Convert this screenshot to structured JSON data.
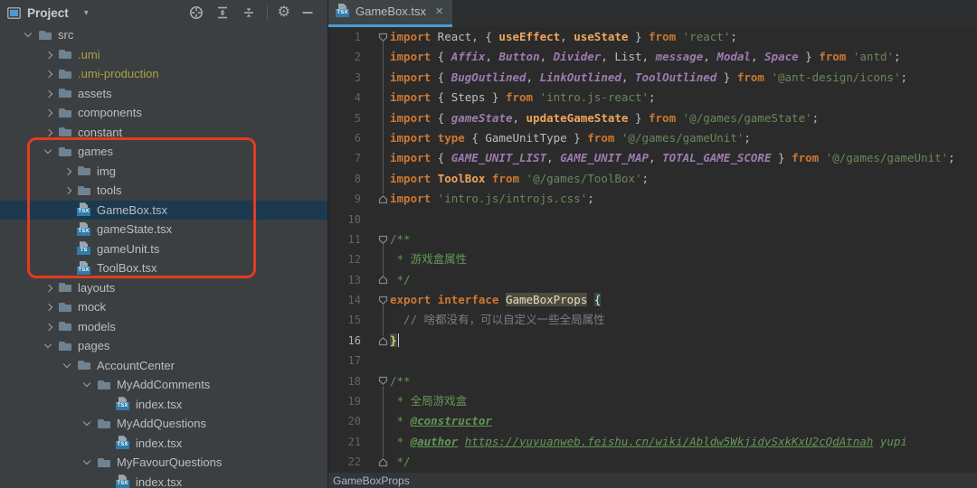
{
  "panel": {
    "header": {
      "title": "Project",
      "dropdown_glyph": "▾",
      "gear_glyph": "⚙",
      "icons": [
        "locate",
        "expand-all",
        "collapse-all",
        "settings",
        "hide-panel"
      ]
    },
    "tree": {
      "rows": [
        {
          "label": "src",
          "level": 0,
          "chev": "open",
          "icon": "folder"
        },
        {
          "label": ".umi",
          "level": 1,
          "chev": "closed",
          "icon": "folder",
          "excluded": true
        },
        {
          "label": ".umi-production",
          "level": 1,
          "chev": "closed",
          "icon": "folder",
          "excluded": true
        },
        {
          "label": "assets",
          "level": 1,
          "chev": "closed",
          "icon": "folder"
        },
        {
          "label": "components",
          "level": 1,
          "chev": "closed",
          "icon": "folder"
        },
        {
          "label": "constant",
          "level": 1,
          "chev": "closed",
          "icon": "folder"
        },
        {
          "label": "games",
          "level": 1,
          "chev": "open",
          "icon": "folder"
        },
        {
          "label": "img",
          "level": 2,
          "chev": "closed",
          "icon": "folder"
        },
        {
          "label": "tools",
          "level": 2,
          "chev": "closed",
          "icon": "folder"
        },
        {
          "label": "GameBox.tsx",
          "level": 2,
          "chev": "none",
          "icon": "tsx",
          "selected": true
        },
        {
          "label": "gameState.tsx",
          "level": 2,
          "chev": "none",
          "icon": "tsx"
        },
        {
          "label": "gameUnit.ts",
          "level": 2,
          "chev": "none",
          "icon": "ts"
        },
        {
          "label": "ToolBox.tsx",
          "level": 2,
          "chev": "none",
          "icon": "tsx"
        },
        {
          "label": "layouts",
          "level": 1,
          "chev": "closed",
          "icon": "folder"
        },
        {
          "label": "mock",
          "level": 1,
          "chev": "closed",
          "icon": "folder"
        },
        {
          "label": "models",
          "level": 1,
          "chev": "closed",
          "icon": "folder"
        },
        {
          "label": "pages",
          "level": 1,
          "chev": "open",
          "icon": "folder"
        },
        {
          "label": "AccountCenter",
          "level": 2,
          "chev": "open",
          "icon": "folder"
        },
        {
          "label": "MyAddComments",
          "level": 3,
          "chev": "open",
          "icon": "folder"
        },
        {
          "label": "index.tsx",
          "level": 4,
          "chev": "none",
          "icon": "tsx"
        },
        {
          "label": "MyAddQuestions",
          "level": 3,
          "chev": "open",
          "icon": "folder"
        },
        {
          "label": "index.tsx",
          "level": 4,
          "chev": "none",
          "icon": "tsx"
        },
        {
          "label": "MyFavourQuestions",
          "level": 3,
          "chev": "open",
          "icon": "folder"
        },
        {
          "label": "index.tsx",
          "level": 4,
          "chev": "none",
          "icon": "tsx"
        }
      ]
    },
    "annotation_color": "#E23B24"
  },
  "editor": {
    "tab": {
      "title": "GameBox.tsx",
      "icon": "tsx",
      "close_glyph": "✕"
    },
    "breadcrumb": "GameBoxProps",
    "code": {
      "current_line": 16,
      "folds": [
        [
          1,
          9
        ],
        [
          11,
          13
        ],
        [
          14,
          16
        ],
        [
          18,
          22
        ]
      ],
      "lines": [
        {
          "n": 1,
          "t": [
            [
              "kw",
              "import"
            ],
            [
              "pl",
              " React, { "
            ],
            [
              "gold",
              "useEffect"
            ],
            [
              "pl",
              ", "
            ],
            [
              "gold",
              "useState"
            ],
            [
              "pl",
              " } "
            ],
            [
              "kw",
              "from"
            ],
            [
              "pl",
              " "
            ],
            [
              "str",
              "'react'"
            ],
            [
              "pl",
              ";"
            ]
          ]
        },
        {
          "n": 2,
          "t": [
            [
              "kw",
              "import"
            ],
            [
              "pl",
              " { "
            ],
            [
              "pur",
              "Affix"
            ],
            [
              "pl",
              ", "
            ],
            [
              "pur",
              "Button"
            ],
            [
              "pl",
              ", "
            ],
            [
              "pur",
              "Divider"
            ],
            [
              "pl",
              ", List, "
            ],
            [
              "pur",
              "message"
            ],
            [
              "pl",
              ", "
            ],
            [
              "pur",
              "Modal"
            ],
            [
              "pl",
              ", "
            ],
            [
              "pur",
              "Space"
            ],
            [
              "pl",
              " } "
            ],
            [
              "kw",
              "from"
            ],
            [
              "pl",
              " "
            ],
            [
              "str",
              "'antd'"
            ],
            [
              "pl",
              ";"
            ]
          ]
        },
        {
          "n": 3,
          "t": [
            [
              "kw",
              "import"
            ],
            [
              "pl",
              " { "
            ],
            [
              "pur",
              "BugOutlined"
            ],
            [
              "pl",
              ", "
            ],
            [
              "pur",
              "LinkOutlined"
            ],
            [
              "pl",
              ", "
            ],
            [
              "pur",
              "ToolOutlined"
            ],
            [
              "pl",
              " } "
            ],
            [
              "kw",
              "from"
            ],
            [
              "pl",
              " "
            ],
            [
              "str",
              "'@ant-design/icons'"
            ],
            [
              "pl",
              ";"
            ]
          ]
        },
        {
          "n": 4,
          "t": [
            [
              "kw",
              "import"
            ],
            [
              "pl",
              " { Steps } "
            ],
            [
              "kw",
              "from"
            ],
            [
              "pl",
              " "
            ],
            [
              "str",
              "'intro.js-react'"
            ],
            [
              "pl",
              ";"
            ]
          ]
        },
        {
          "n": 5,
          "t": [
            [
              "kw",
              "import"
            ],
            [
              "pl",
              " { "
            ],
            [
              "pur",
              "gameState"
            ],
            [
              "pl",
              ", "
            ],
            [
              "gold",
              "updateGameState"
            ],
            [
              "pl",
              " } "
            ],
            [
              "kw",
              "from"
            ],
            [
              "pl",
              " "
            ],
            [
              "str",
              "'@/games/gameState'"
            ],
            [
              "pl",
              ";"
            ]
          ]
        },
        {
          "n": 6,
          "t": [
            [
              "kw",
              "import"
            ],
            [
              "pl",
              " "
            ],
            [
              "kw",
              "type"
            ],
            [
              "pl",
              " { GameUnitType } "
            ],
            [
              "kw",
              "from"
            ],
            [
              "pl",
              " "
            ],
            [
              "str",
              "'@/games/gameUnit'"
            ],
            [
              "pl",
              ";"
            ]
          ]
        },
        {
          "n": 7,
          "t": [
            [
              "kw",
              "import"
            ],
            [
              "pl",
              " { "
            ],
            [
              "pur",
              "GAME_UNIT_LIST"
            ],
            [
              "pl",
              ", "
            ],
            [
              "pur",
              "GAME_UNIT_MAP"
            ],
            [
              "pl",
              ", "
            ],
            [
              "pur",
              "TOTAL_GAME_SCORE"
            ],
            [
              "pl",
              " } "
            ],
            [
              "kw",
              "from"
            ],
            [
              "pl",
              " "
            ],
            [
              "str",
              "'@/games/gameUnit'"
            ],
            [
              "pl",
              ";"
            ]
          ]
        },
        {
          "n": 8,
          "t": [
            [
              "kw",
              "import"
            ],
            [
              "pl",
              " "
            ],
            [
              "gold",
              "ToolBox"
            ],
            [
              "pl",
              " "
            ],
            [
              "kw",
              "from"
            ],
            [
              "pl",
              " "
            ],
            [
              "str",
              "'@/games/ToolBox'"
            ],
            [
              "pl",
              ";"
            ]
          ]
        },
        {
          "n": 9,
          "t": [
            [
              "kw",
              "import"
            ],
            [
              "pl",
              " "
            ],
            [
              "str",
              "'intro.js/introjs.css'"
            ],
            [
              "pl",
              ";"
            ]
          ]
        },
        {
          "n": 10,
          "t": []
        },
        {
          "n": 11,
          "t": [
            [
              "doc",
              "/**"
            ]
          ]
        },
        {
          "n": 12,
          "t": [
            [
              "doc",
              " * 游戏盒属性"
            ]
          ]
        },
        {
          "n": 13,
          "t": [
            [
              "doc",
              " */"
            ]
          ]
        },
        {
          "n": 14,
          "t": [
            [
              "kw",
              "export"
            ],
            [
              "pl",
              " "
            ],
            [
              "kw",
              "interface"
            ],
            [
              "pl",
              " "
            ],
            [
              "hlid",
              "GameBoxProps"
            ],
            [
              "pl",
              " "
            ],
            [
              "hlbr",
              "{"
            ]
          ]
        },
        {
          "n": 15,
          "t": [
            [
              "cmt",
              "  // 啥都没有，可以自定义一些全局属性"
            ]
          ]
        },
        {
          "n": 16,
          "t": [
            [
              "hlbr2",
              "}"
            ],
            [
              "caret",
              ""
            ]
          ]
        },
        {
          "n": 17,
          "t": []
        },
        {
          "n": 18,
          "t": [
            [
              "doc",
              "/**"
            ]
          ]
        },
        {
          "n": 19,
          "t": [
            [
              "doc",
              " * 全局游戏盒"
            ]
          ]
        },
        {
          "n": 20,
          "t": [
            [
              "doc",
              " * "
            ],
            [
              "tag",
              "@constructor"
            ]
          ]
        },
        {
          "n": 21,
          "t": [
            [
              "doc",
              " * "
            ],
            [
              "tag",
              "@author"
            ],
            [
              "doc",
              " "
            ],
            [
              "url",
              "https://yuyuanweb.feishu.cn/wiki/Abldw5WkjidySxkKxU2cQdAtnah"
            ],
            [
              "iti",
              " yupi"
            ]
          ]
        },
        {
          "n": 22,
          "t": [
            [
              "doc",
              " */"
            ]
          ]
        }
      ]
    }
  },
  "colors": {
    "selection": "#1B3A50",
    "editor_bg": "#2B2B2B",
    "panel_bg": "#3C3F41",
    "tab_underline": "#4A9BD5",
    "red_box": "#E23B24"
  }
}
